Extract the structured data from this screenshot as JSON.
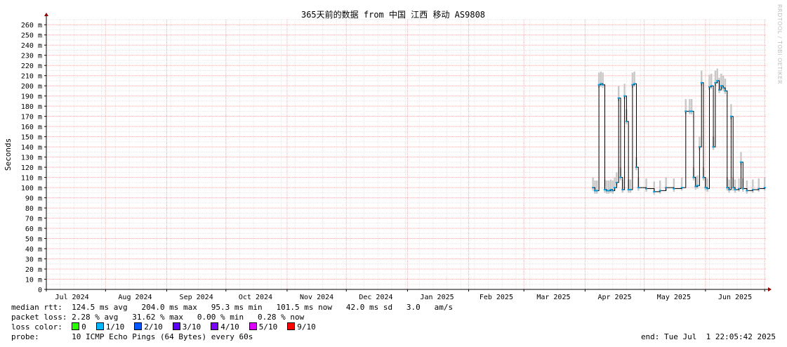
{
  "watermark": "RRDTOOL / TOBI OETIKER",
  "chart_data": {
    "type": "line",
    "title": "365天前的数据 from 中国 江西 移动 AS9808",
    "ylabel": "Seconds",
    "ylim": [
      0,
      265
    ],
    "yticks": [
      {
        "v": 0,
        "label": "0"
      },
      {
        "v": 10,
        "label": "10 m"
      },
      {
        "v": 20,
        "label": "20 m"
      },
      {
        "v": 30,
        "label": "30 m"
      },
      {
        "v": 40,
        "label": "40 m"
      },
      {
        "v": 50,
        "label": "50 m"
      },
      {
        "v": 60,
        "label": "60 m"
      },
      {
        "v": 70,
        "label": "70 m"
      },
      {
        "v": 80,
        "label": "80 m"
      },
      {
        "v": 90,
        "label": "90 m"
      },
      {
        "v": 100,
        "label": "100 m"
      },
      {
        "v": 110,
        "label": "110 m"
      },
      {
        "v": 120,
        "label": "120 m"
      },
      {
        "v": 130,
        "label": "130 m"
      },
      {
        "v": 140,
        "label": "140 m"
      },
      {
        "v": 150,
        "label": "150 m"
      },
      {
        "v": 160,
        "label": "160 m"
      },
      {
        "v": 170,
        "label": "170 m"
      },
      {
        "v": 180,
        "label": "180 m"
      },
      {
        "v": 190,
        "label": "190 m"
      },
      {
        "v": 200,
        "label": "200 m"
      },
      {
        "v": 210,
        "label": "210 m"
      },
      {
        "v": 220,
        "label": "220 m"
      },
      {
        "v": 230,
        "label": "230 m"
      },
      {
        "v": 240,
        "label": "240 m"
      },
      {
        "v": 250,
        "label": "250 m"
      },
      {
        "v": 260,
        "label": "260 m"
      }
    ],
    "xlim": [
      "2024-07-02",
      "2025-07-02"
    ],
    "x_month_starts": [
      "2024-07-02",
      "2024-08-01",
      "2024-09-01",
      "2024-10-01",
      "2024-11-01",
      "2024-12-01",
      "2025-01-01",
      "2025-02-01",
      "2025-03-01",
      "2025-04-01",
      "2025-05-01",
      "2025-06-01",
      "2025-07-01"
    ],
    "x_labels": [
      {
        "date": "2024-07-15",
        "label": "Jul 2024"
      },
      {
        "date": "2024-08-16",
        "label": "Aug 2024"
      },
      {
        "date": "2024-09-16",
        "label": "Sep 2024"
      },
      {
        "date": "2024-10-16",
        "label": "Oct 2024"
      },
      {
        "date": "2024-11-16",
        "label": "Nov 2024"
      },
      {
        "date": "2024-12-16",
        "label": "Dec 2024"
      },
      {
        "date": "2025-01-16",
        "label": "Jan 2025"
      },
      {
        "date": "2025-02-15",
        "label": "Feb 2025"
      },
      {
        "date": "2025-03-16",
        "label": "Mar 2025"
      },
      {
        "date": "2025-04-16",
        "label": "Apr 2025"
      },
      {
        "date": "2025-05-16",
        "label": "May 2025"
      },
      {
        "date": "2025-06-16",
        "label": "Jun 2025"
      }
    ],
    "grid": true,
    "series": [
      {
        "color": "#00a0e0",
        "points": [
          [
            "2025-04-05",
            100
          ],
          [
            "2025-04-06",
            97
          ],
          [
            "2025-04-07",
            97
          ],
          [
            "2025-04-08",
            201
          ],
          [
            "2025-04-09",
            202
          ],
          [
            "2025-04-10",
            201
          ],
          [
            "2025-04-11",
            98
          ],
          [
            "2025-04-12",
            97
          ],
          [
            "2025-04-13",
            97
          ],
          [
            "2025-04-14",
            98
          ],
          [
            "2025-04-15",
            97
          ],
          [
            "2025-04-16",
            100
          ],
          [
            "2025-04-17",
            105
          ],
          [
            "2025-04-18",
            188
          ],
          [
            "2025-04-19",
            110
          ],
          [
            "2025-04-20",
            98
          ],
          [
            "2025-04-21",
            190
          ],
          [
            "2025-04-22",
            165
          ],
          [
            "2025-04-23",
            98
          ],
          [
            "2025-04-24",
            98
          ],
          [
            "2025-04-25",
            201
          ],
          [
            "2025-04-26",
            202
          ],
          [
            "2025-04-27",
            120
          ],
          [
            "2025-04-28",
            100
          ],
          [
            "2025-05-02",
            99
          ],
          [
            "2025-05-06",
            96
          ],
          [
            "2025-05-09",
            97
          ],
          [
            "2025-05-12",
            100
          ],
          [
            "2025-05-16",
            99
          ],
          [
            "2025-05-20",
            100
          ],
          [
            "2025-05-22",
            175
          ],
          [
            "2025-05-24",
            175
          ],
          [
            "2025-05-25",
            175
          ],
          [
            "2025-05-26",
            110
          ],
          [
            "2025-05-27",
            101
          ],
          [
            "2025-05-28",
            102
          ],
          [
            "2025-05-29",
            140
          ],
          [
            "2025-05-30",
            203
          ],
          [
            "2025-05-31",
            110
          ],
          [
            "2025-06-01",
            100
          ],
          [
            "2025-06-02",
            99
          ],
          [
            "2025-06-03",
            199
          ],
          [
            "2025-06-04",
            200
          ],
          [
            "2025-06-05",
            140
          ],
          [
            "2025-06-06",
            203
          ],
          [
            "2025-06-07",
            205
          ],
          [
            "2025-06-08",
            196
          ],
          [
            "2025-06-09",
            200
          ],
          [
            "2025-06-10",
            198
          ],
          [
            "2025-06-11",
            195
          ],
          [
            "2025-06-12",
            100
          ],
          [
            "2025-06-13",
            98
          ],
          [
            "2025-06-14",
            170
          ],
          [
            "2025-06-15",
            100
          ],
          [
            "2025-06-16",
            98
          ],
          [
            "2025-06-18",
            99
          ],
          [
            "2025-06-19",
            125
          ],
          [
            "2025-06-20",
            99
          ],
          [
            "2025-06-22",
            97
          ],
          [
            "2025-06-25",
            98
          ],
          [
            "2025-06-28",
            99
          ],
          [
            "2025-07-01",
            100
          ]
        ]
      }
    ]
  },
  "stats": {
    "rtt_label": "median rtt:",
    "rtt_values": "124.5 ms avg   204.0 ms max   95.3 ms min   101.5 ms now   42.0 ms sd   3.0   am/s",
    "loss_label": "packet loss:",
    "loss_values": "2.28 % avg   31.62 % max   0.00 % min   0.28 % now",
    "color_label": "loss color:",
    "loss_colors": [
      {
        "label": "0",
        "color": "#26ff00"
      },
      {
        "label": "1/10",
        "color": "#00b8ff"
      },
      {
        "label": "2/10",
        "color": "#0059ff"
      },
      {
        "label": "3/10",
        "color": "#5e00ff"
      },
      {
        "label": "4/10",
        "color": "#7e00ff"
      },
      {
        "label": "5/10",
        "color": "#dd00ff"
      },
      {
        "label": "9/10",
        "color": "#ff0000"
      }
    ],
    "probe_label": "probe:",
    "probe_value": "10 ICMP Echo Pings (64 Bytes) every 60s",
    "end_text": "end: Tue Jul  1 22:05:42 2025"
  }
}
